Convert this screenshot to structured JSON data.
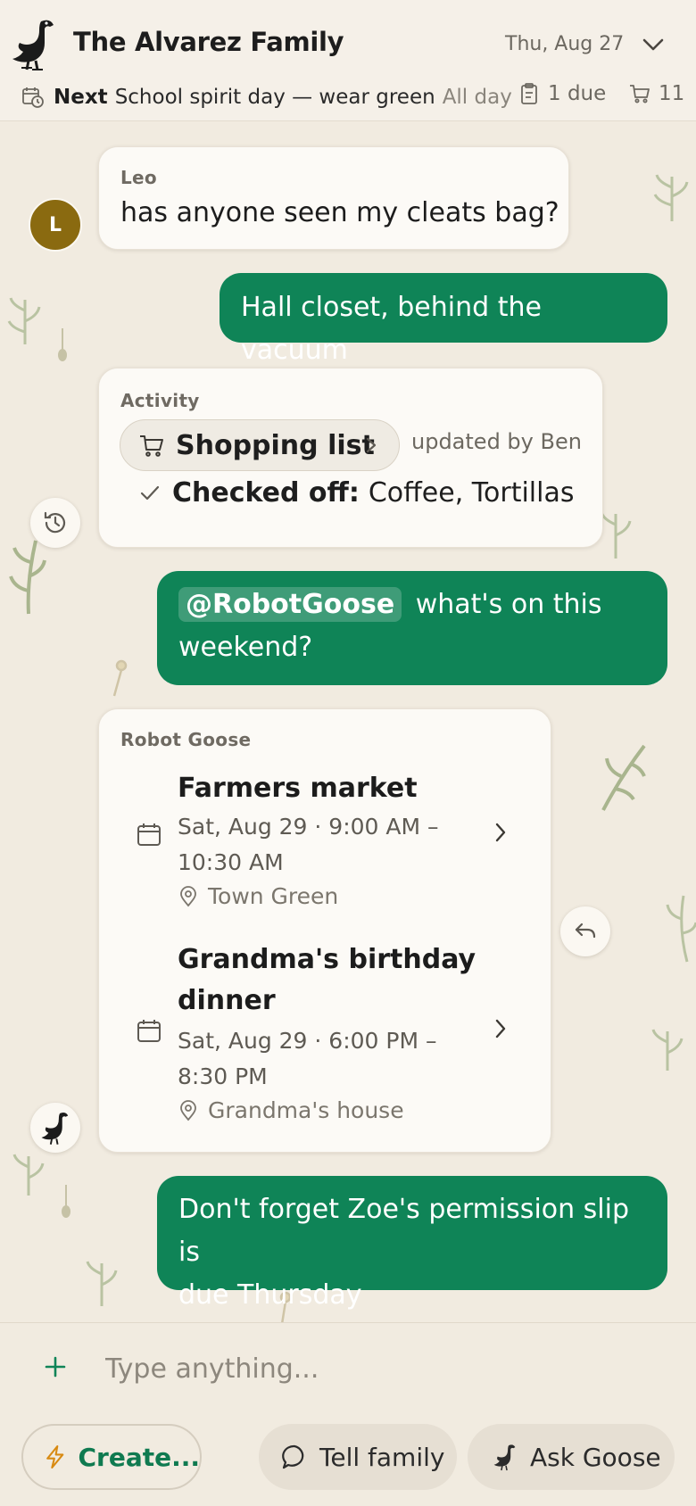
{
  "header": {
    "title": "The Alvarez Family",
    "date": "Thu, Aug 27",
    "next_label": "Next",
    "next_event": "School spirit day — wear green",
    "next_when": "All day",
    "due_count": "1 due",
    "cart_count": "11"
  },
  "messages": {
    "leo": {
      "avatar_initial": "L",
      "sender": "Leo",
      "text": "has anyone seen my cleats bag?"
    },
    "reply_1": {
      "text": "Hall closet, behind the vacuum"
    },
    "activity": {
      "sender": "Activity",
      "chip_label": "Shopping list",
      "updated_by": "updated by Ben",
      "checked_label": "Checked off:",
      "checked_items": "Coffee, Tortillas"
    },
    "ask": {
      "mention": "@RobotGoose",
      "text_line1": "what's on this",
      "text_line2": "weekend?"
    },
    "goose": {
      "sender": "Robot Goose",
      "events": [
        {
          "title": "Farmers market",
          "time_line1": "Sat, Aug 29 · 9:00 AM –",
          "time_line2": "10:30 AM",
          "location": "Town Green"
        },
        {
          "title_line1": "Grandma's birthday",
          "title_line2": "dinner",
          "time_line1": "Sat, Aug 29 · 6:00 PM –",
          "time_line2": "8:30 PM",
          "location": "Grandma's house"
        }
      ]
    },
    "reminder": {
      "line1": "Don't forget Zoe's permission slip is",
      "line2": "due Thursday"
    }
  },
  "composer": {
    "placeholder": "Type anything...",
    "create_label": "Create...",
    "tell_label": "Tell family",
    "ask_label": "Ask Goose"
  },
  "icons": {
    "logo": "goose-icon",
    "next": "calendar-clock-icon",
    "due": "clipboard-icon",
    "cart": "cart-icon",
    "history": "history-icon",
    "reply": "reply-icon",
    "event": "calendar-icon",
    "location": "location-pin-icon",
    "plus": "plus-icon",
    "create": "lightning-icon",
    "tell": "chat-bubble-icon"
  },
  "colors": {
    "background": "#f1ebe0",
    "accent_green": "#0f8457",
    "card": "#fcfaf6",
    "avatar_leo": "#8a6a10"
  }
}
